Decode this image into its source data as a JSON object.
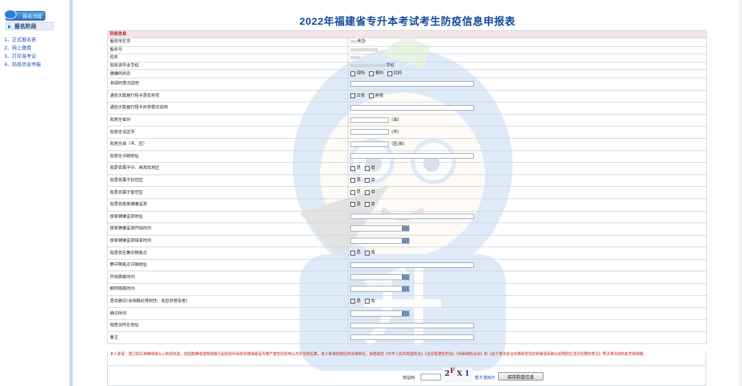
{
  "sidebar": {
    "flow_label": "报名流程",
    "stage_label": "报名阶段",
    "steps": [
      {
        "label": "1、正式报名表"
      },
      {
        "label": "2、网上缴费"
      },
      {
        "label": "3、打印准考证"
      },
      {
        "label": "4、防疫信息申报"
      }
    ]
  },
  "title": "2022年福建省专升本考试考生防疫信息申报表",
  "form": {
    "section_label": "防疫信息",
    "options": {
      "green": "绿码",
      "yellow": "黄码",
      "red": "红码",
      "normal": "正常",
      "abnormal": "异常",
      "yes": "是",
      "no": "否",
      "province_suffix": "(省)",
      "city_suffix": "(市)",
      "county_suffix": "(区/县)"
    },
    "rows": {
      "city": {
        "label": "报名所在市",
        "value": "考办"
      },
      "regno": {
        "label": "报名号"
      },
      "name": {
        "label": "姓名"
      },
      "school": {
        "label": "现就读毕业学校",
        "value": "学校"
      },
      "health_code": {
        "label": "健康码状态"
      },
      "non_green": {
        "label": "非绿码情况说明"
      },
      "trip_card": {
        "label": "通信大数据行程卡是否异常"
      },
      "trip_abnormal": {
        "label": "通信大数据行程卡异常情况说明"
      },
      "province": {
        "label": "现居住省份"
      },
      "city_live": {
        "label": "现居住设区市"
      },
      "county": {
        "label": "现居住县（市、区）"
      },
      "address": {
        "label": "现居住详细地址"
      },
      "risk_area": {
        "label": "现是否属于中、高风险地区"
      },
      "sealed_area": {
        "label": "现是否属于封控区"
      },
      "control_area": {
        "label": "现是否属于管控区"
      },
      "home_monitor": {
        "label": "现是否居家健康监测"
      },
      "home_address": {
        "label": "居家健康监测地址"
      },
      "home_start": {
        "label": "居家健康监测开始时间"
      },
      "home_end": {
        "label": "居家健康监测结束时间"
      },
      "quarantine": {
        "label": "现是否在集中隔离点"
      },
      "quarantine_addr": {
        "label": "集中隔离点详细地址"
      },
      "q_start": {
        "label": "开始隔离时间"
      },
      "q_end": {
        "label": "解除隔离时间"
      },
      "confirmed": {
        "label": "是否确诊(含核酸初筛阳性、无症状感染者)"
      },
      "confirm_time": {
        "label": "确诊时间"
      },
      "hospital": {
        "label": "现医治所在地址"
      },
      "remark": {
        "label": "备注"
      }
    }
  },
  "promise": "本人承诺：我已如实准确填报以上防疫信息。如因隐瞒或虚假填报引起检疫传染病传播或者有传播严重危险影响公共安全的后果，本人将承担相应的法律责任，自愿接受《中华人民共和国刑法》《治安管理处罚法》《传染病防治法》和《关于依法惩治妨害新型冠状病毒感染肺炎疫情防控违法犯罪的意见》等法律法规的处罚和制裁。",
  "captcha": {
    "label": "验证码",
    "chars": [
      "2",
      "F",
      "X",
      "1"
    ],
    "refresh": "看不清图片",
    "submit": "保存防疫信息"
  },
  "colors": {
    "title": "#124a9c",
    "section_text": "#b22222",
    "link": "#1b55b5",
    "border": "#cfd8e3"
  }
}
